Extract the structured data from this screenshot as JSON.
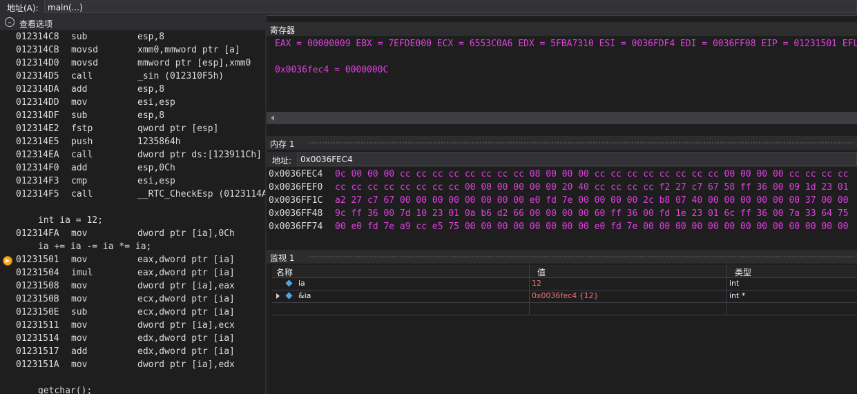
{
  "address_bar": {
    "label": "地址(A):",
    "value": "main(...)"
  },
  "view_options": {
    "label": "查看选项",
    "icon": "chevron-down-icon"
  },
  "disassembly": [
    {
      "addr": "012314C8",
      "mn": "sub",
      "op": "esp,8"
    },
    {
      "addr": "012314CB",
      "mn": "movsd",
      "op": "xmm0,mmword ptr [a]"
    },
    {
      "addr": "012314D0",
      "mn": "movsd",
      "op": "mmword ptr [esp],xmm0"
    },
    {
      "addr": "012314D5",
      "mn": "call",
      "op": "_sin (012310F5h)"
    },
    {
      "addr": "012314DA",
      "mn": "add",
      "op": "esp,8"
    },
    {
      "addr": "012314DD",
      "mn": "mov",
      "op": "esi,esp"
    },
    {
      "addr": "012314DF",
      "mn": "sub",
      "op": "esp,8"
    },
    {
      "addr": "012314E2",
      "mn": "fstp",
      "op": "qword ptr [esp]"
    },
    {
      "addr": "012314E5",
      "mn": "push",
      "op": "1235864h"
    },
    {
      "addr": "012314EA",
      "mn": "call",
      "op": "dword ptr ds:[123911Ch]"
    },
    {
      "addr": "012314F0",
      "mn": "add",
      "op": "esp,0Ch"
    },
    {
      "addr": "012314F3",
      "mn": "cmp",
      "op": "esi,esp"
    },
    {
      "addr": "012314F5",
      "mn": "call",
      "op": "__RTC_CheckEsp (0123114A"
    },
    {
      "src": ""
    },
    {
      "src": "int ia = 12;"
    },
    {
      "addr": "012314FA",
      "mn": "mov",
      "op": "dword ptr [ia],0Ch"
    },
    {
      "src": "ia += ia -= ia *= ia;"
    },
    {
      "addr": "01231501",
      "mn": "mov",
      "op": "eax,dword ptr [ia]",
      "current": true
    },
    {
      "addr": "01231504",
      "mn": "imul",
      "op": "eax,dword ptr [ia]"
    },
    {
      "addr": "01231508",
      "mn": "mov",
      "op": "dword ptr [ia],eax"
    },
    {
      "addr": "0123150B",
      "mn": "mov",
      "op": "ecx,dword ptr [ia]"
    },
    {
      "addr": "0123150E",
      "mn": "sub",
      "op": "ecx,dword ptr [ia]"
    },
    {
      "addr": "01231511",
      "mn": "mov",
      "op": "dword ptr [ia],ecx"
    },
    {
      "addr": "01231514",
      "mn": "mov",
      "op": "edx,dword ptr [ia]"
    },
    {
      "addr": "01231517",
      "mn": "add",
      "op": "edx,dword ptr [ia]"
    },
    {
      "addr": "0123151A",
      "mn": "mov",
      "op": "dword ptr [ia],edx"
    },
    {
      "src": ""
    },
    {
      "src": "getchar();"
    }
  ],
  "registers": {
    "title": "寄存器",
    "line1": "EAX = 00000009 EBX = 7EFDE000 ECX = 6553C0A6 EDX = 5FBA7310 ESI = 0036FDF4 EDI = 0036FF08 EIP = 01231501 EFL",
    "line2": "0x0036fec4 = 0000000C"
  },
  "memory": {
    "title": "内存 1",
    "addr_label": "地址:",
    "addr_value": "0x0036FEC4",
    "rows": [
      {
        "addr": "0x0036FEC4",
        "bytes": "0c 00 00 00 cc cc cc cc cc cc cc cc 08 00 00 00 cc cc cc cc cc cc cc cc 00 00 00 00 cc cc cc cc"
      },
      {
        "addr": "0x0036FEF0",
        "bytes": "cc cc cc cc cc cc cc cc 00 00 00 00 00 00 20 40 cc cc cc cc f2 27 c7 67 58 ff 36 00 09 1d 23 01"
      },
      {
        "addr": "0x0036FF1C",
        "bytes": "a2 27 c7 67 00 00 00 00 00 00 00 00 e0 fd 7e 00 00 00 00 2c b8 07 40 00 00 00 00 00 00 37 00 00"
      },
      {
        "addr": "0x0036FF48",
        "bytes": "9c ff 36 00 7d 10 23 01 0a b6 d2 66 00 00 00 00 60 ff 36 00 fd 1e 23 01 6c ff 36 00 7a 33 64 75"
      },
      {
        "addr": "0x0036FF74",
        "bytes": "00 e0 fd 7e a9 cc e5 75 00 00 00 00 00 00 00 00 e0 fd 7e 00 00 00 00 00 00 00 00 00 00 00 00 00"
      }
    ]
  },
  "watch": {
    "title": "监视 1",
    "headers": {
      "name": "名称",
      "value": "值",
      "type": "类型"
    },
    "rows": [
      {
        "name": "ia",
        "value": "12",
        "type": "int",
        "expandable": false
      },
      {
        "name": "&ia",
        "value": "0x0036fec4 {12}",
        "type": "int *",
        "expandable": true
      }
    ]
  }
}
